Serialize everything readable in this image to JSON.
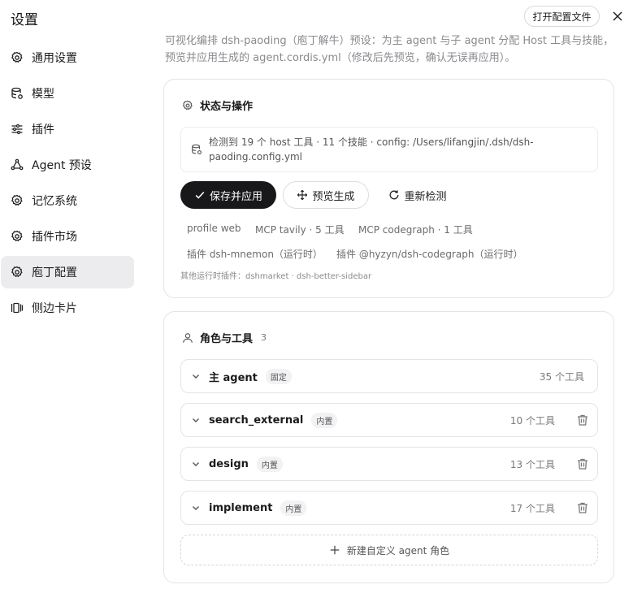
{
  "sidebar": {
    "title": "设置",
    "items": [
      {
        "label": "通用设置",
        "icon": "gear-icon"
      },
      {
        "label": "模型",
        "icon": "database-icon"
      },
      {
        "label": "插件",
        "icon": "sliders-icon"
      },
      {
        "label": "Agent 预设",
        "icon": "agent-icon"
      },
      {
        "label": "记忆系统",
        "icon": "gear-icon"
      },
      {
        "label": "插件市场",
        "icon": "gear-icon"
      },
      {
        "label": "庖丁配置",
        "icon": "gear-icon",
        "active": true
      },
      {
        "label": "侧边卡片",
        "icon": "cards-icon"
      }
    ]
  },
  "header": {
    "open_config_label": "打开配置文件",
    "close_icon": "close-icon"
  },
  "description": "可视化编排 dsh-paoding（庖丁解牛）预设：为主 agent 与子 agent 分配 Host 工具与技能，预览并应用生成的 agent.cordis.yml（修改后先预览，确认无误再应用）。",
  "status_card": {
    "title": "状态与操作",
    "info": "检测到 19 个 host 工具 · 11 个技能 · config: /Users/lifangjin/.dsh/dsh-paoding.config.yml",
    "buttons": {
      "save": "保存并应用",
      "preview": "预览生成",
      "recheck": "重新检测"
    },
    "chips_row1": [
      "profile web",
      "MCP tavily · 5 工具",
      "MCP codegraph · 1 工具"
    ],
    "chips_row2": [
      "插件 dsh-mnemon（运行时）",
      "插件 @hyzyn/dsh-codegraph（运行时）"
    ],
    "other_plugins": "其他运行时插件：dshmarket · dsh-better-sidebar"
  },
  "roles_card": {
    "title": "角色与工具",
    "count": "3",
    "roles": [
      {
        "name": "主 agent",
        "tag": "固定",
        "tools": "35 个工具",
        "deletable": false
      },
      {
        "name": "search_external",
        "tag": "内置",
        "tools": "10 个工具",
        "deletable": true
      },
      {
        "name": "design",
        "tag": "内置",
        "tools": "13 个工具",
        "deletable": true
      },
      {
        "name": "implement",
        "tag": "内置",
        "tools": "17 个工具",
        "deletable": true
      }
    ],
    "new_role_label": "新建自定义 agent 角色"
  }
}
